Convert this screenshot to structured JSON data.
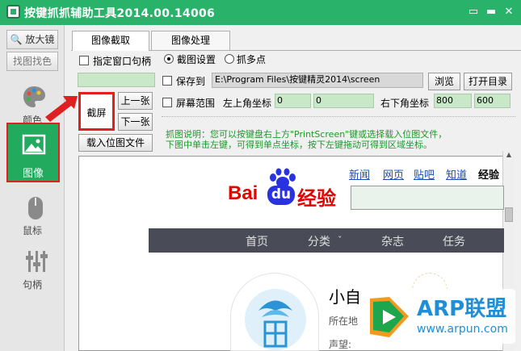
{
  "window": {
    "title": "按键抓抓辅助工具2014.00.14006",
    "controls": [
      "▭",
      "▬",
      "✕"
    ]
  },
  "sidebar": {
    "magnifier_label": "放大镜",
    "find_color_label": "找图找色",
    "items": [
      {
        "label": "颜色",
        "icon": "palette-icon"
      },
      {
        "label": "图像",
        "icon": "picture-icon",
        "selected": true
      },
      {
        "label": "鼠标",
        "icon": "mouse-icon"
      },
      {
        "label": "句柄",
        "icon": "sliders-icon"
      }
    ],
    "accent": "#22aa5e"
  },
  "tabs": [
    {
      "label": "图像截取",
      "active": true
    },
    {
      "label": "图像处理",
      "active": false
    }
  ],
  "capture": {
    "window_handle_label": "指定窗口句柄",
    "window_handle_checked": false,
    "mode_capture_label": "截图设置",
    "mode_points_label": "抓多点",
    "mode_selected": "截图设置",
    "save_label": "保存到",
    "save_checked": false,
    "save_path": "E:\\Program Files\\按键精灵2014\\screen",
    "browse_label": "浏览",
    "open_dir_label": "打开目录",
    "screen_range_label": "屏幕范围",
    "screen_range_checked": false,
    "top_left_label": "左上角坐标",
    "top_left_x": "0",
    "top_left_y": "0",
    "bottom_right_label": "右下角坐标",
    "bottom_right_x": "800",
    "bottom_right_y": "600",
    "capture_label": "截屏",
    "prev_label": "上一张",
    "next_label": "下一张",
    "load_image_label": "载入位图文件",
    "note_line1": "抓图说明：您可以按键盘右上方\"PrintScreen\"键或选择载入位图文件，",
    "note_line2": "下图中单击左键，可得到单点坐标，按下左键拖动可得到区域坐标。"
  },
  "preview": {
    "logo_bai": "Bai",
    "logo_du": "du",
    "logo_suffix": "经验",
    "top_links": [
      "新闻",
      "网页",
      "贴吧",
      "知道",
      "经验"
    ],
    "nav": [
      "首页",
      "分类",
      "杂志",
      "任务"
    ],
    "nav_dropdown_marker": "ˇ",
    "profile_name": "小自",
    "profile_location": "所在地",
    "profile_statement": "声望:",
    "watermark_brand": "ARP联盟",
    "watermark_url": "www.arpun.com",
    "colors": {
      "nav_bg": "#494c56",
      "baidu_red": "#e10602",
      "baidu_blue": "#2932e1"
    }
  },
  "highlight_color": "#e02020"
}
